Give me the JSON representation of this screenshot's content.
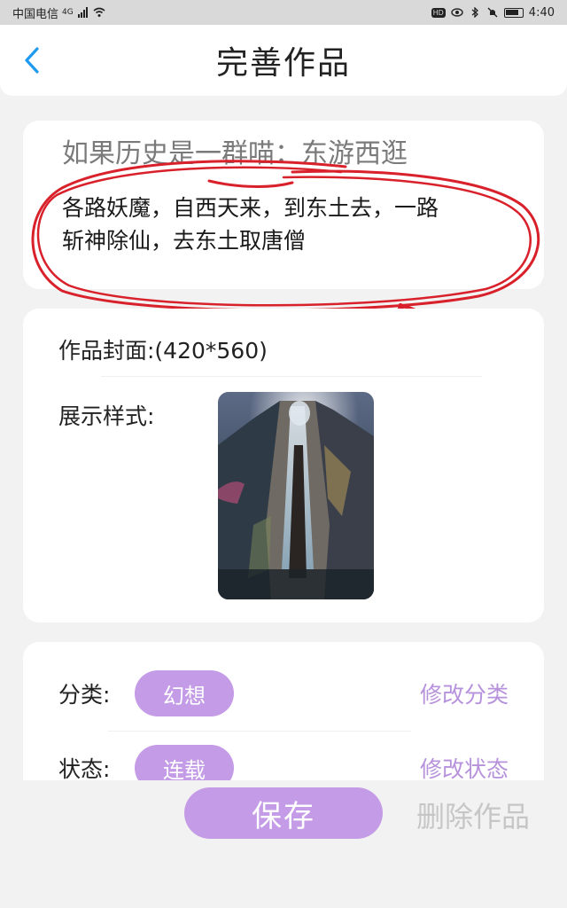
{
  "status_bar": {
    "carrier": "中国电信",
    "network": "4G",
    "time": "4:40",
    "hd_badge": "HD"
  },
  "header": {
    "title": "完善作品"
  },
  "work": {
    "title": "如果历史是一群喵：东游西逛",
    "description_line1": "各路妖魔，自西天来，到东土去，一路",
    "description_line2": "斩神除仙，去东土取唐僧"
  },
  "cover": {
    "label": "作品封面:(420*560)",
    "style_label": "展示样式:"
  },
  "meta": {
    "category_label": "分类:",
    "category_value": "幻想",
    "category_action": "修改分类",
    "status_label": "状态:",
    "status_value": "连载",
    "status_action": "修改状态"
  },
  "actions": {
    "save": "保存",
    "delete": "删除作品"
  },
  "colors": {
    "accent": "#c49be6",
    "accent_text": "#b792dc",
    "back_icon": "#1e9bf0",
    "annotation": "#d8212b"
  },
  "icons": [
    "back-arrow-icon",
    "signal-icon",
    "wifi-icon",
    "eye-icon",
    "bluetooth-icon",
    "mute-icon",
    "battery-icon"
  ]
}
